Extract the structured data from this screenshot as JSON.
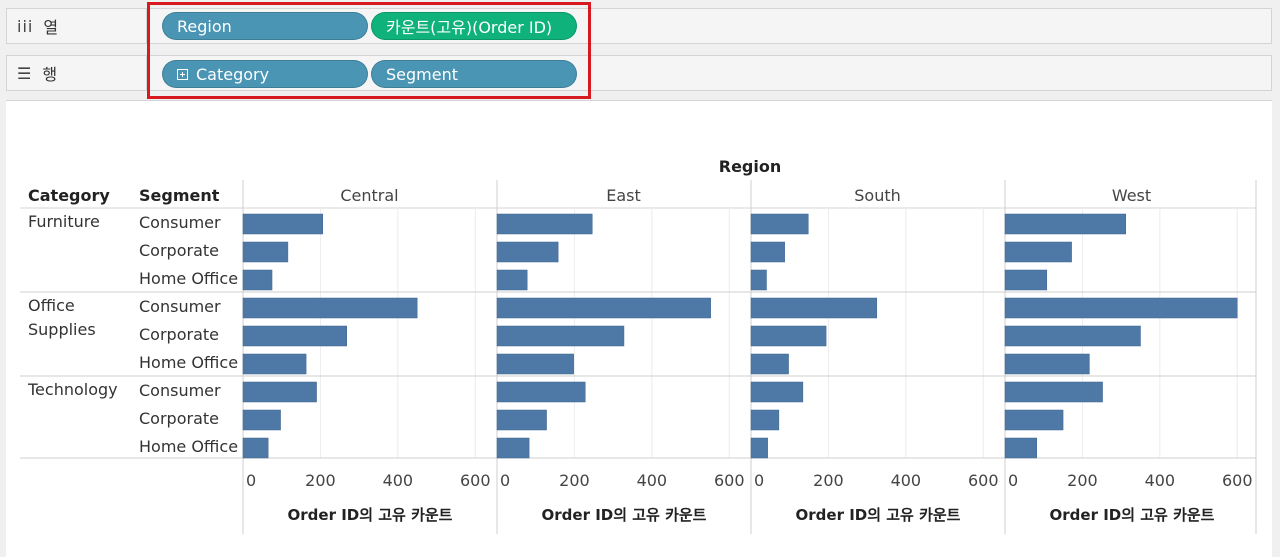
{
  "shelves": {
    "columns": {
      "label": "열",
      "icon": "columns-icon",
      "pills": [
        {
          "label": "Region",
          "kind": "dimension"
        },
        {
          "label": "카운트(고유)(Order ID)",
          "kind": "measure"
        }
      ]
    },
    "rows": {
      "label": "행",
      "icon": "rows-icon",
      "pills": [
        {
          "label": "Category",
          "kind": "dimension",
          "expand": true
        },
        {
          "label": "Segment",
          "kind": "dimension"
        }
      ]
    }
  },
  "colors": {
    "bar": "#4e79a7",
    "dimension_pill": "#4a95b4",
    "measure_pill": "#0fb27b",
    "highlight": "#d71921"
  },
  "chart_data": {
    "type": "bar",
    "orientation": "horizontal",
    "column_header": "Region",
    "row_headers": [
      "Category",
      "Segment"
    ],
    "regions": [
      "Central",
      "East",
      "South",
      "West"
    ],
    "categories": [
      {
        "name": "Furniture",
        "segments": [
          "Consumer",
          "Corporate",
          "Home Office"
        ]
      },
      {
        "name": "Office Supplies",
        "segments": [
          "Consumer",
          "Corporate",
          "Home Office"
        ]
      },
      {
        "name": "Technology",
        "segments": [
          "Consumer",
          "Corporate",
          "Home Office"
        ]
      }
    ],
    "values": {
      "Central": [
        206,
        116,
        75,
        450,
        268,
        163,
        190,
        97,
        65
      ],
      "East": [
        246,
        158,
        78,
        552,
        328,
        198,
        228,
        128,
        83
      ],
      "South": [
        148,
        87,
        40,
        325,
        194,
        97,
        134,
        72,
        43
      ],
      "West": [
        312,
        172,
        108,
        600,
        350,
        218,
        252,
        150,
        82
      ]
    },
    "xlabel": "Order ID의 고유 카운트",
    "xticks": [
      0,
      200,
      400,
      600
    ],
    "xlim": [
      0,
      620
    ]
  }
}
